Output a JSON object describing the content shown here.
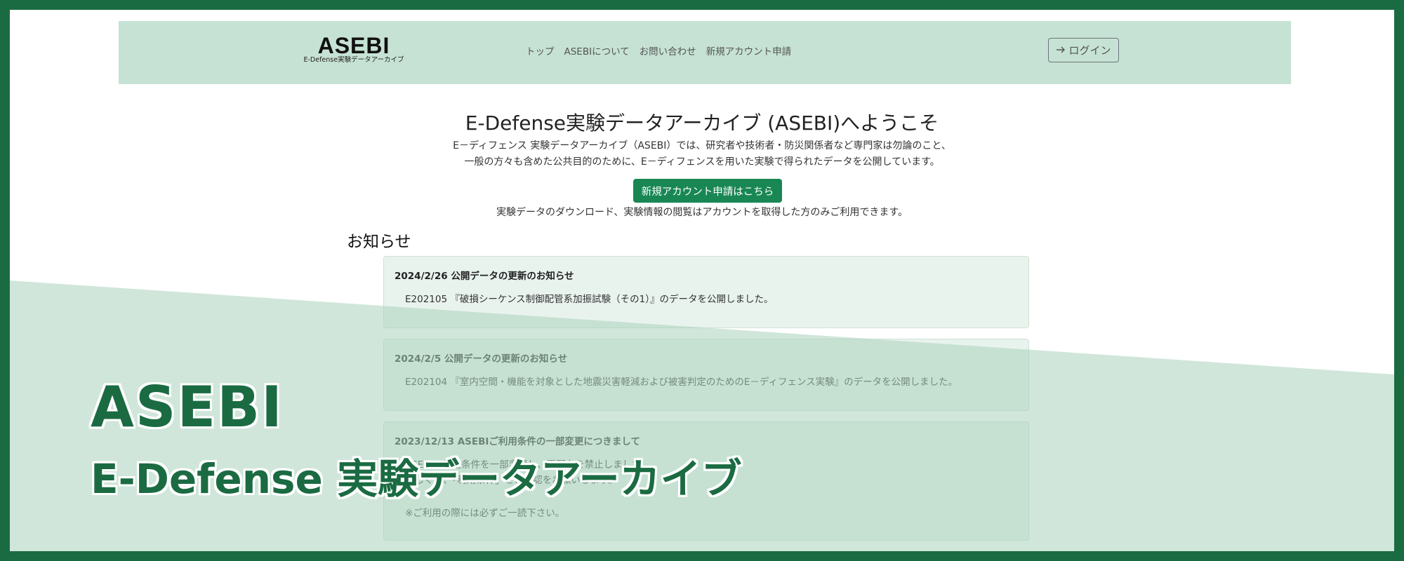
{
  "navbar": {
    "logo_main": "ASEBI",
    "logo_sub": "E-Defense実験データアーカイブ",
    "links": [
      "トップ",
      "ASEBIについて",
      "お問い合わせ",
      "新規アカウント申請"
    ],
    "login_icon": "arrow-right-icon",
    "login_label": "ログイン"
  },
  "welcome": {
    "title": "E-Defense実験データアーカイブ (ASEBI)へようこそ",
    "desc_line1": "E－ディフェンス 実験データアーカイブ（ASEBI）では、研究者や技術者・防災関係者など専門家は勿論のこと、",
    "desc_line2": "一般の方々も含めた公共目的のために、E－ディフェンスを用いた実験で得られたデータを公開しています。",
    "signup_button": "新規アカウント申請はこちら",
    "signup_note": "実験データのダウンロード、実験情報の閲覧はアカウントを取得した方のみご利用できます。"
  },
  "news": {
    "heading": "お知らせ",
    "items": [
      {
        "title": "2024/2/26 公開データの更新のお知らせ",
        "body": "E202105 『破損シーケンス制御配管系加振試験（その1）』のデータを公開しました。"
      },
      {
        "title": "2024/2/5 公開データの更新のお知らせ",
        "body": "E202104 『室内空間・機能を対象とした地震災害軽減および被害判定のためのE－ディフェンス実験』のデータを公開しました。"
      },
      {
        "title": "2023/12/13 ASEBIご利用条件の一部変更につきまして",
        "body_line1": "ASEBIの利用条件を一部変更し、再配布を禁止しました。",
        "body_line2": "詳しくは、「利用条件」をご確認をお願いします。",
        "extra": "※ご利用の際には必ずご一読下さい。"
      }
    ]
  },
  "hero": {
    "title": "ASEBI",
    "subtitle": "E-Defense 実験データアーカイブ"
  },
  "colors": {
    "frame": "#1b6b42",
    "navbar_bg": "#c6e2d4",
    "accent": "#198754",
    "band": "#a9d2bb"
  }
}
